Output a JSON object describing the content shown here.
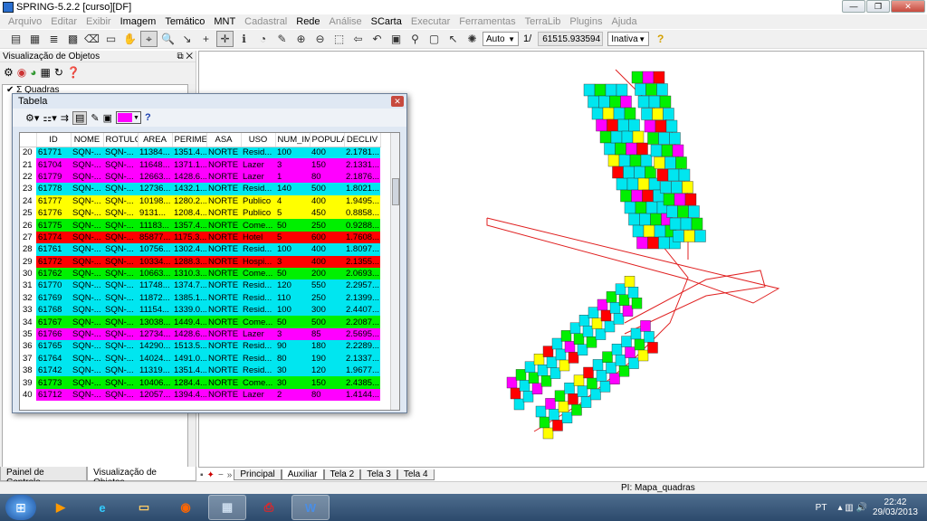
{
  "window": {
    "title": "SPRING-5.2.2 [curso][DF]",
    "btn_min": "—",
    "btn_max": "❐",
    "btn_close": "✕"
  },
  "menu": [
    "Arquivo",
    "Editar",
    "Exibir",
    "Imagem",
    "Temático",
    "MNT",
    "Cadastral",
    "Rede",
    "Análise",
    "SCarta",
    "Executar",
    "Ferramentas",
    "TerraLib",
    "Plugins",
    "Ajuda"
  ],
  "menu_enabled": [
    "Imagem",
    "Temático",
    "MNT",
    "Rede",
    "SCarta"
  ],
  "toolbar": {
    "zoom_mode": "Auto",
    "scale_prefix": "1/",
    "scale_value": "61515.933594",
    "status_mode": "Inativa"
  },
  "left_panel": {
    "title": "Visualização de Objetos",
    "tree_item": "Quadras",
    "tabs": [
      "Painel de Controle",
      "Visualização de Objetos"
    ]
  },
  "table_window": {
    "title": "Tabela",
    "columns": [
      "ID",
      "NOME",
      "ROTULO",
      "AREA",
      "PERIMETR",
      "ASA",
      "USO",
      "NUM_IMO",
      "POPULAC",
      "DECLIV"
    ],
    "rows": [
      {
        "n": "20",
        "c": "cyan",
        "v": [
          "61771",
          "SQN-...",
          "SQN-...",
          "11384...",
          "1351.4...",
          "NORTE",
          "Resid...",
          "100",
          "400",
          "2.1781..."
        ]
      },
      {
        "n": "21",
        "c": "magenta",
        "v": [
          "61704",
          "SQN-...",
          "SQN-...",
          "11648...",
          "1371.1...",
          "NORTE",
          "Lazer",
          "3",
          "150",
          "2.1331..."
        ]
      },
      {
        "n": "22",
        "c": "magenta",
        "v": [
          "61779",
          "SQN-...",
          "SQN-...",
          "12663...",
          "1428.6...",
          "NORTE",
          "Lazer",
          "1",
          "80",
          "2.1876..."
        ]
      },
      {
        "n": "23",
        "c": "cyan",
        "v": [
          "61778",
          "SQN-...",
          "SQN-...",
          "12736...",
          "1432.1...",
          "NORTE",
          "Resid...",
          "140",
          "500",
          "1.8021..."
        ]
      },
      {
        "n": "24",
        "c": "yellow",
        "v": [
          "61777",
          "SQN-...",
          "SQN-...",
          "10198...",
          "1280.2...",
          "NORTE",
          "Publico",
          "4",
          "400",
          "1.9495..."
        ]
      },
      {
        "n": "25",
        "c": "yellow",
        "v": [
          "61776",
          "SQN-...",
          "SQN-...",
          "9131...",
          "1208.4...",
          "NORTE",
          "Publico",
          "5",
          "450",
          "0.8858..."
        ]
      },
      {
        "n": "26",
        "c": "green",
        "v": [
          "61775",
          "SQN-...",
          "SQN-...",
          "11183...",
          "1357.4...",
          "NORTE",
          "Come...",
          "50",
          "250",
          "0.9288..."
        ]
      },
      {
        "n": "27",
        "c": "red",
        "v": [
          "61774",
          "SQN-...",
          "SQN-...",
          "85877...",
          "1175.3...",
          "NORTE",
          "Hotel",
          "5",
          "600",
          "1.7608..."
        ]
      },
      {
        "n": "28",
        "c": "cyan",
        "v": [
          "61761",
          "SQN-...",
          "SQN-...",
          "10756...",
          "1302.4...",
          "NORTE",
          "Resid...",
          "100",
          "400",
          "1.8097..."
        ]
      },
      {
        "n": "29",
        "c": "red",
        "v": [
          "61772",
          "SQN-...",
          "SQN-...",
          "10334...",
          "1288.3...",
          "NORTE",
          "Hospi...",
          "3",
          "400",
          "2.1355..."
        ]
      },
      {
        "n": "30",
        "c": "green",
        "v": [
          "61762",
          "SQN-...",
          "SQN-...",
          "10663...",
          "1310.3...",
          "NORTE",
          "Come...",
          "50",
          "200",
          "2.0693..."
        ]
      },
      {
        "n": "31",
        "c": "cyan",
        "v": [
          "61770",
          "SQN-...",
          "SQN-...",
          "11748...",
          "1374.7...",
          "NORTE",
          "Resid...",
          "120",
          "550",
          "2.2957..."
        ]
      },
      {
        "n": "32",
        "c": "cyan",
        "v": [
          "61769",
          "SQN-...",
          "SQN-...",
          "11872...",
          "1385.1...",
          "NORTE",
          "Resid...",
          "110",
          "250",
          "2.1399..."
        ]
      },
      {
        "n": "33",
        "c": "cyan",
        "v": [
          "61768",
          "SQN-...",
          "SQN-...",
          "11154...",
          "1339.0...",
          "NORTE",
          "Resid...",
          "100",
          "300",
          "2.4407..."
        ]
      },
      {
        "n": "34",
        "c": "green",
        "v": [
          "61767",
          "SQN-...",
          "SQN-...",
          "13038...",
          "1449.4...",
          "NORTE",
          "Come...",
          "50",
          "500",
          "2.2087..."
        ]
      },
      {
        "n": "35",
        "c": "magenta",
        "v": [
          "61766",
          "SQN-...",
          "SQN-...",
          "12734...",
          "1428.6...",
          "NORTE",
          "Lazer",
          "3",
          "85",
          "2.5695..."
        ]
      },
      {
        "n": "36",
        "c": "cyan",
        "v": [
          "61765",
          "SQN-...",
          "SQN-...",
          "14290...",
          "1513.5...",
          "NORTE",
          "Resid...",
          "90",
          "180",
          "2.2289..."
        ]
      },
      {
        "n": "37",
        "c": "cyan",
        "v": [
          "61764",
          "SQN-...",
          "SQN-...",
          "14024...",
          "1491.0...",
          "NORTE",
          "Resid...",
          "80",
          "190",
          "2.1337..."
        ]
      },
      {
        "n": "38",
        "c": "cyan",
        "v": [
          "61742",
          "SQN-...",
          "SQN-...",
          "11319...",
          "1351.4...",
          "NORTE",
          "Resid...",
          "30",
          "120",
          "1.9677..."
        ]
      },
      {
        "n": "39",
        "c": "green",
        "v": [
          "61773",
          "SQN-...",
          "SQN-...",
          "10406...",
          "1284.4...",
          "NORTE",
          "Come...",
          "30",
          "150",
          "2.4385..."
        ]
      },
      {
        "n": "40",
        "c": "magenta",
        "v": [
          "61712",
          "SQN-...",
          "SQN-...",
          "12057...",
          "1394.4...",
          "NORTE",
          "Lazer",
          "2",
          "80",
          "1.4144..."
        ]
      }
    ]
  },
  "colors": {
    "cyan": "#00e6f0",
    "magenta": "#ff00ff",
    "yellow": "#ffff00",
    "green": "#00f000",
    "red": "#ff0000",
    "outline": "#e02020"
  },
  "bottom_tabs": [
    "Principal",
    "Auxiliar",
    "Tela 2",
    "Tela 3",
    "Tela 4"
  ],
  "bottom_tabs_active": "Auxiliar",
  "status": {
    "pi": "PI: Mapa_quadras"
  },
  "taskbar": {
    "lang": "PT",
    "time": "22:42",
    "date": "29/03/2013"
  }
}
